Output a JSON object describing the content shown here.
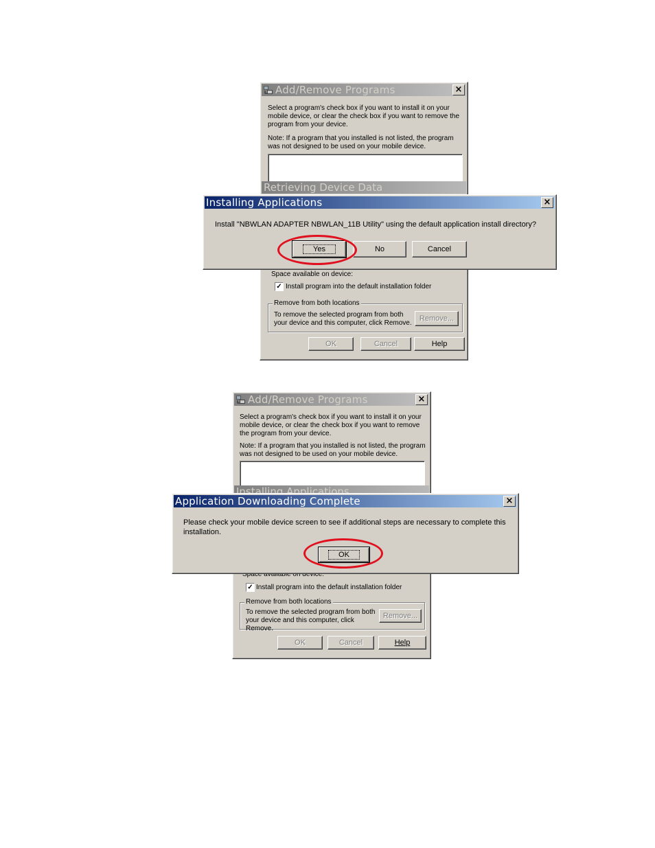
{
  "panel1": {
    "bg_window": {
      "title": "Add/Remove Programs",
      "close": "×",
      "instructions": "Select a program's check box if you want to install it on your mobile device, or clear the check box if you want to remove the program from your device.",
      "note": "Note:  If a program that you installed is not listed, the program was not designed to be used on your mobile device.",
      "progress_title": "Retrieving Device Data",
      "space_label": "Space available on device:",
      "checkbox_label": "Install program into the default installation folder",
      "checkbox_checked": "✓",
      "group_label": "Remove from both locations",
      "group_text": "To remove the selected program from both your device and this computer, click Remove.",
      "remove_label": "Remove...",
      "ok_label": "OK",
      "cancel_label": "Cancel",
      "help_label": "Help"
    },
    "dialog": {
      "title": "Installing Applications",
      "close": "×",
      "message": "Install \"NBWLAN ADAPTER NBWLAN_11B Utility\" using the default application install directory?",
      "yes_label": "Yes",
      "no_label": "No",
      "cancel_label": "Cancel"
    }
  },
  "panel2": {
    "bg_window": {
      "title": "Add/Remove Programs",
      "close": "×",
      "instructions": "Select a program's check box if you want to install it on your mobile device, or clear the check box if you want to remove the program from your device.",
      "note": "Note:  If a program that you installed is not listed, the program was not designed to be used on your mobile device.",
      "progress_title": "Installing Applications",
      "space_label": "Space available on device:",
      "checkbox_label": "Install program into the default installation folder",
      "checkbox_checked": "✓",
      "group_label": "Remove from both locations",
      "group_text": "To remove the selected program from both your device and this computer, click Remove.",
      "remove_label": "Remove...",
      "ok_label": "OK",
      "cancel_label": "Cancel",
      "help_label": "Help"
    },
    "dialog": {
      "title": "Application Downloading Complete",
      "close": "×",
      "message": "Please check your mobile device screen to see if additional steps are necessary to complete this installation.",
      "ok_label": "OK"
    }
  },
  "colors": {
    "highlight_circle": "#e0101e",
    "active_title": "#0a246a",
    "dialog_face": "#d4d0c8"
  }
}
